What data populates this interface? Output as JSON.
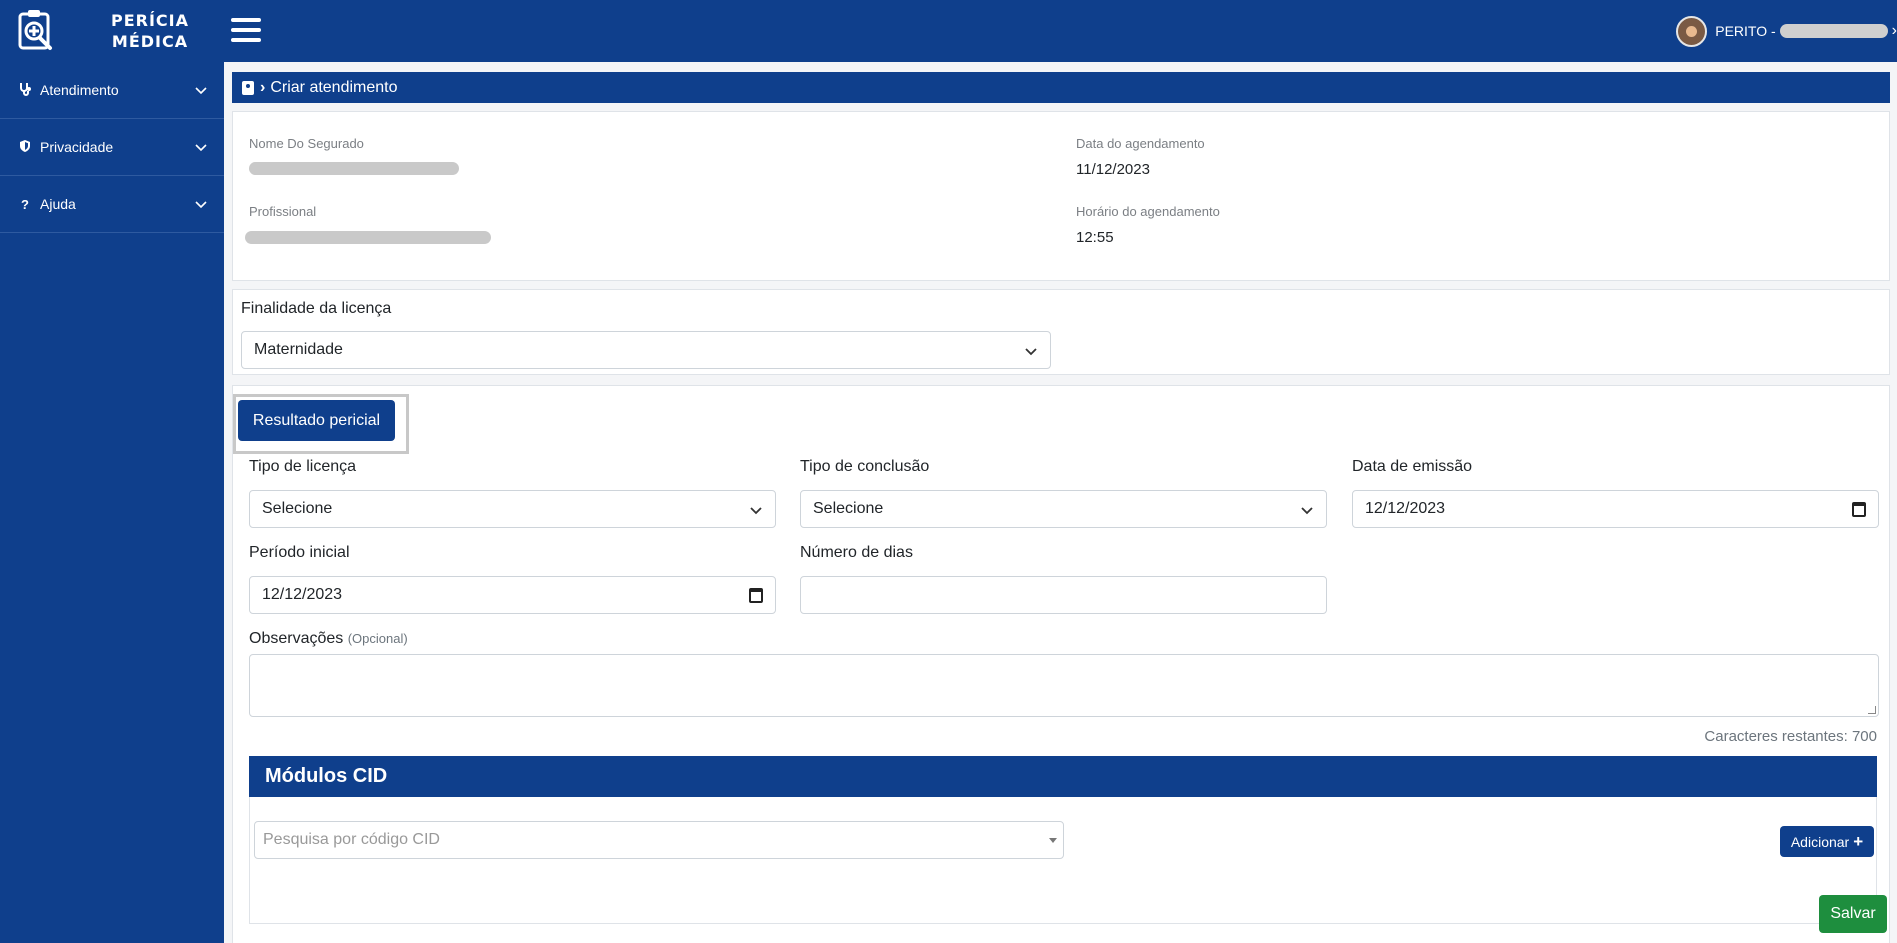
{
  "header": {
    "brand_line1": "PERÍCIA",
    "brand_line2": "MÉDICA",
    "user_prefix": "PERITO -",
    "user_chevron": "›"
  },
  "sidebar": {
    "items": [
      {
        "label": "Atendimento",
        "icon": "stethoscope-icon"
      },
      {
        "label": "Privacidade",
        "icon": "shield-icon"
      },
      {
        "label": "Ajuda",
        "icon": "question-icon"
      }
    ]
  },
  "breadcrumb": {
    "separator": "›",
    "title": "Criar atendimento"
  },
  "info": {
    "nome_label": "Nome Do Segurado",
    "profissional_label": "Profissional",
    "data_label": "Data do agendamento",
    "data_value": "11/12/2023",
    "horario_label": "Horário do agendamento",
    "horario_value": "12:55"
  },
  "finalidade": {
    "label": "Finalidade da licença",
    "value": "Maternidade"
  },
  "resultado": {
    "button_label": "Resultado pericial",
    "tipo_licenca_label": "Tipo de licença",
    "tipo_licenca_value": "Selecione",
    "tipo_conclusao_label": "Tipo de conclusão",
    "tipo_conclusao_value": "Selecione",
    "data_emissao_label": "Data de emissão",
    "data_emissao_value": "12/12/2023",
    "periodo_inicial_label": "Período inicial",
    "periodo_inicial_value": "12/12/2023",
    "numero_dias_label": "Número de dias",
    "numero_dias_value": "",
    "observacoes_label": "Observações",
    "observacoes_optional": "(Opcional)",
    "caracteres": "Caracteres restantes: 700"
  },
  "cid": {
    "title": "Módulos CID",
    "search_placeholder": "Pesquisa por código CID",
    "add_label": "Adicionar",
    "add_symbol": "+"
  },
  "actions": {
    "save_label": "Salvar"
  },
  "colors": {
    "primary": "#0f3f8c",
    "success": "#1e8e3e"
  }
}
